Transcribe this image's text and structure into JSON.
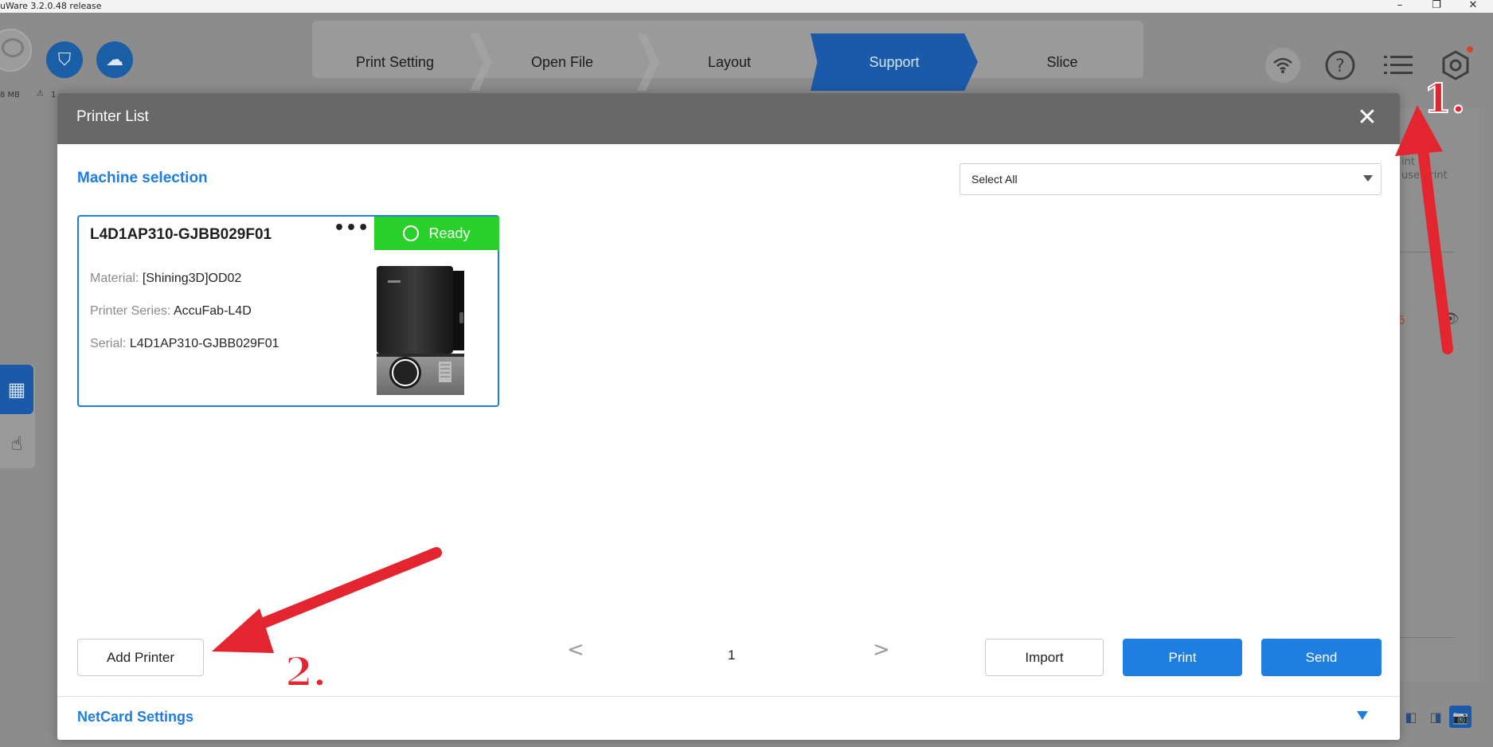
{
  "window": {
    "title": "uWare 3.2.0.48 release"
  },
  "app": {
    "memory_text": "8 MB",
    "warning_text": "1",
    "workflow": {
      "steps": [
        "Print Setting",
        "Open File",
        "Layout",
        "Support",
        "Slice"
      ],
      "active_step": "Support"
    },
    "right_panel": {
      "text_line1": "int",
      "text_line2": "use print",
      "red_value": "6"
    }
  },
  "dialog": {
    "title": "Printer List",
    "machine_selection_label": "Machine selection",
    "select": {
      "value": "Select All"
    },
    "printers": [
      {
        "name": "L4D1AP310-GJBB029F01",
        "more_label": "•••",
        "status": "Ready",
        "material_label": "Material:",
        "material_value": "[Shining3D]OD02",
        "series_label": "Printer Series:",
        "series_value": "AccuFab-L4D",
        "serial_label": "Serial:",
        "serial_value": "L4D1AP310-GJBB029F01"
      }
    ],
    "add_printer_label": "Add Printer",
    "pager": {
      "prev": "<",
      "page": "1",
      "next": ">"
    },
    "import_label": "Import",
    "print_label": "Print",
    "send_label": "Send",
    "netcard_label": "NetCard Settings"
  },
  "annotations": {
    "label_1": "1.",
    "label_2": "2.",
    "color": "#e32530"
  },
  "colors": {
    "accent": "#1f7fe0",
    "status_ready": "#2bd12b",
    "header": "#686868"
  }
}
